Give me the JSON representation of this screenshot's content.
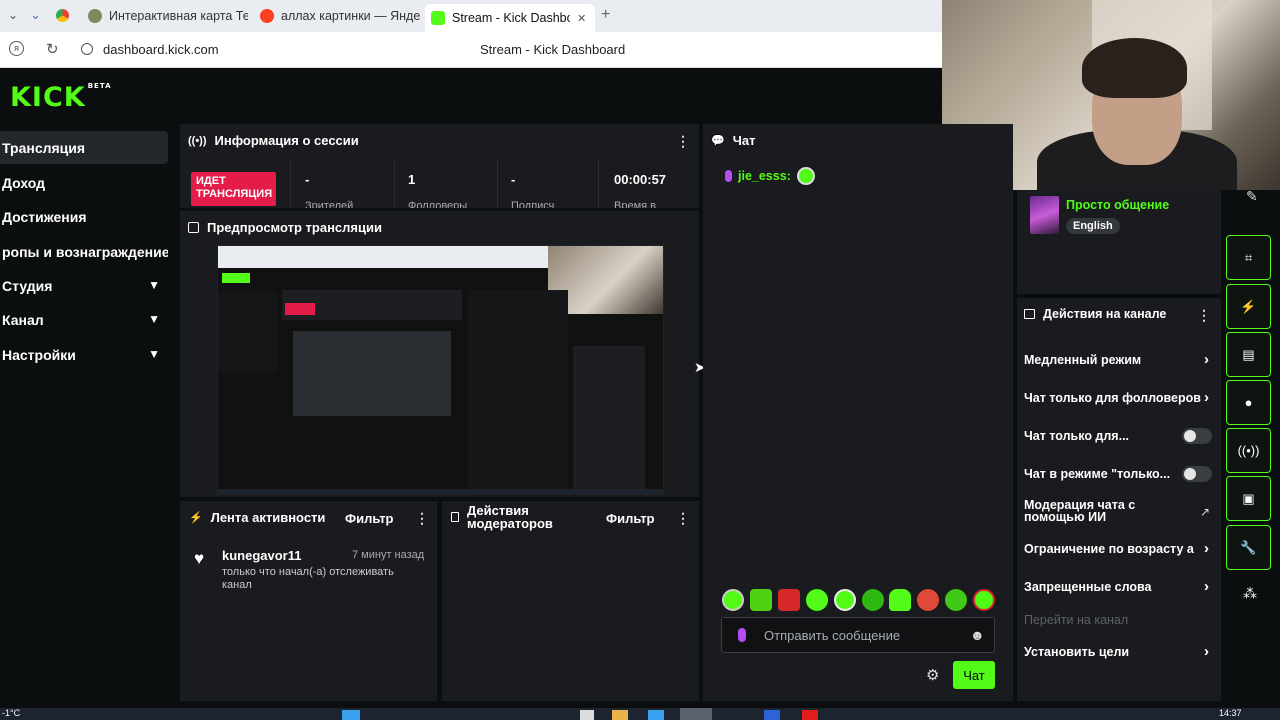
{
  "browser": {
    "tabs": [
      {
        "label": "Интерактивная карта Тей"
      },
      {
        "label": "аллах картинки — Яндекс"
      },
      {
        "label": "Stream - Kick Dashboard",
        "close": "✕"
      }
    ],
    "new_tab": "+",
    "url": "dashboard.kick.com",
    "page_title": "Stream - Kick Dashboard"
  },
  "app": {
    "logo": "KICK",
    "logo_badge": "BETA",
    "accent": "#53fc18"
  },
  "sidebar": {
    "items": [
      {
        "label": "Трансляция"
      },
      {
        "label": "Доход"
      },
      {
        "label": "Достижения"
      },
      {
        "label": "ропы и вознаграждение"
      },
      {
        "label": "Студия"
      },
      {
        "label": "Канал"
      },
      {
        "label": "Настройки"
      }
    ]
  },
  "session": {
    "title": "Информация о сессии",
    "live_line1": "ИДЕТ",
    "live_line2": "ТРАНСЛЯЦИЯ",
    "stats": [
      {
        "value": "-",
        "label": "Зрителей"
      },
      {
        "value": "1",
        "label": "Фолловеры"
      },
      {
        "value": "-",
        "label": "Подписч"
      },
      {
        "value": "00:00:57",
        "label": "Время в"
      }
    ]
  },
  "preview": {
    "title": "Предпросмотр трансляции"
  },
  "activity": {
    "title": "Лента активности",
    "filter": "Фильтр",
    "items": [
      {
        "user": "kunegavor11",
        "time": "7 минут назад",
        "text": "только что начал(-а) отслеживать канал"
      }
    ]
  },
  "mod_actions": {
    "title": "Действия модераторов",
    "filter": "Фильтр"
  },
  "chat": {
    "title": "Чат",
    "messages": [
      {
        "user": "jie_esss:"
      }
    ],
    "placeholder": "Отправить сообщение",
    "send": "Чат"
  },
  "stream_info": {
    "category": "Просто общение",
    "language": "English"
  },
  "channel_actions": {
    "title": "Действия на канале",
    "items": [
      {
        "label": "Медленный режим"
      },
      {
        "label": "Чат только для фолловеров"
      },
      {
        "label": "Чат только для..."
      },
      {
        "label": "Чат в режиме \"только..."
      },
      {
        "label": "Модерация чата с помощью ИИ"
      },
      {
        "label": "Ограничение по возрасту ау"
      },
      {
        "label": "Запрещенные слова"
      },
      {
        "label": "Перейти на канал"
      },
      {
        "label": "Установить цели"
      }
    ]
  },
  "taskbar": {
    "temp": "-1°C",
    "clock": "14:37"
  }
}
